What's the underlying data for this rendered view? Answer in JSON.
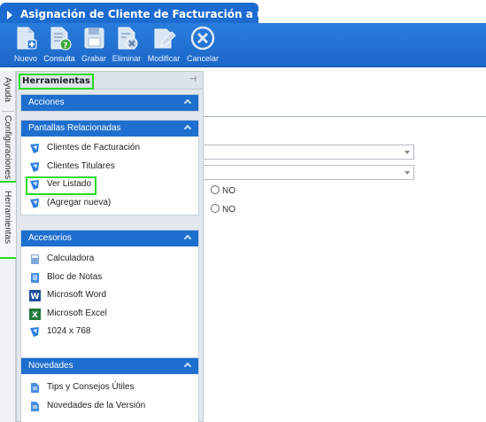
{
  "window": {
    "title": "Asignación de Cliente de Facturación a un Titular"
  },
  "toolbar": {
    "buttons": [
      {
        "label": "Nuevo",
        "icon": "new-document-icon"
      },
      {
        "label": "Consulta",
        "icon": "query-icon"
      },
      {
        "label": "Grabar",
        "icon": "save-icon"
      },
      {
        "label": "Eliminar",
        "icon": "delete-icon"
      },
      {
        "label": "Modificar",
        "icon": "edit-icon"
      },
      {
        "label": "Cancelar",
        "icon": "cancel-icon"
      }
    ]
  },
  "vertical_tabs": [
    "Ayuda",
    "Configuraciones",
    "Herramientas"
  ],
  "panel": {
    "title": "Herramientas",
    "sections": [
      {
        "title": "Acciones",
        "items": []
      },
      {
        "title": "Pantallas Relacionadas",
        "items": [
          "Clientes de Facturación",
          "Clientes Titulares",
          "Ver Listado",
          "(Agregar nueva)"
        ]
      },
      {
        "title": "Accesorios",
        "items": [
          "Calculadora",
          "Bloc de Notas",
          "Microsoft Word",
          "Microsoft Excel",
          "1024 x 768"
        ]
      },
      {
        "title": "Novedades",
        "items": [
          "Tips y Consejos Útiles",
          "Novedades de la Versión"
        ]
      }
    ]
  },
  "form": {
    "radio_1": "NO",
    "radio_2": "NO"
  },
  "colors": {
    "title_bar": "#1c6bd0",
    "section_header": "#1f6fcf",
    "highlight": "#22dd22"
  }
}
